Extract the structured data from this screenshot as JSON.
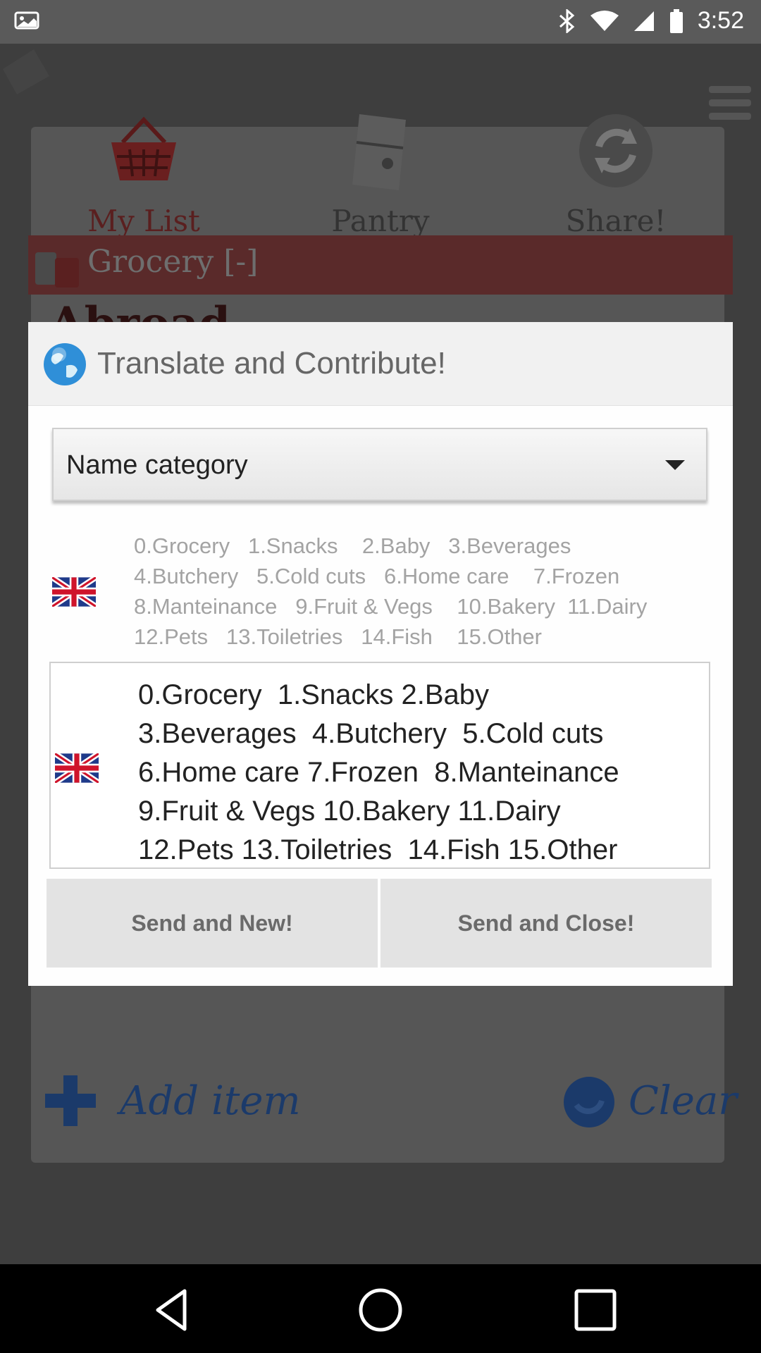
{
  "status_bar": {
    "time": "3:52"
  },
  "app": {
    "nav": [
      {
        "label": "My List",
        "color": "#5a1f1f"
      },
      {
        "label": "Pantry",
        "color": "#3a3a3a"
      },
      {
        "label": "Share!",
        "color": "#3a3a3a"
      }
    ],
    "grocery_header": "Grocery [-]",
    "list_title": "Abroad",
    "add_item_label": "Add item",
    "clear_label": "Clear"
  },
  "dialog": {
    "title": "Translate and Contribute!",
    "category_select": {
      "value": "Name category"
    },
    "hint_lines": [
      [
        "0.Grocery",
        "1.Snacks",
        "2.Baby",
        "3.Beverages"
      ],
      [
        "4.Butchery",
        "5.Cold cuts",
        "6.Home care",
        "7.Frozen"
      ],
      [
        "8.Manteinance",
        "9.Fruit & Vegs",
        "10.Bakery",
        "11.Dairy"
      ],
      [
        "12.Pets",
        "13.Toiletries",
        "14.Fish",
        "15.Other"
      ]
    ],
    "edit_lines": [
      [
        "0.Grocery",
        "1.Snacks",
        "2.Baby"
      ],
      [
        "3.Beverages",
        "4.Butchery",
        "5.Cold cuts"
      ],
      [
        "6.Home care",
        "7.Frozen",
        "8.Manteinance"
      ],
      [
        "9.Fruit & Vegs",
        "10.Bakery",
        "11.Dairy"
      ],
      [
        "12.Pets",
        "13.Toiletries",
        "14.Fish",
        "15.Other"
      ]
    ],
    "send_new_label": "Send and New!",
    "send_close_label": "Send and Close!"
  },
  "colors": {
    "dialog_bg": "#fefefe",
    "header_bg": "#f1f1f1",
    "button_bg": "#e3e3e3"
  }
}
